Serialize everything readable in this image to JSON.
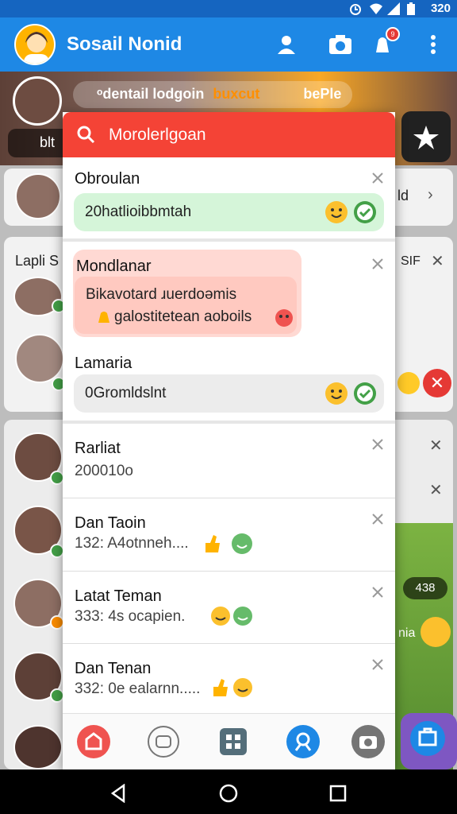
{
  "status_bar": {
    "time": "320"
  },
  "app_bar": {
    "title": "Sosail Nonid",
    "notification_count": "9"
  },
  "background": {
    "story_text": "ᵒdentail lodgoin",
    "story_highlight": "buxcut",
    "story_tail": "bePle",
    "pill_text": "blt",
    "card1_side_text": "ld",
    "card2_title": "Lapli S",
    "card2_side_text": "SIF",
    "map_value": "438",
    "map_label": "nia"
  },
  "modal": {
    "header_title": "Morolerlgoan",
    "rows": [
      {
        "name": "Obroulan",
        "bubble_text": "20hatlioibbmtah"
      },
      {
        "name": "Mondlanar",
        "bubble_line1": "Bikavotard ɹuerdoəmis",
        "bubble_line2": "galostitetean aoboils"
      },
      {
        "name": "Lamaria",
        "bubble_text": "0Gromldslnt"
      },
      {
        "name": "Rarliat",
        "sub": "200010o"
      },
      {
        "name": "Dan Taoin",
        "sub": "132: A4otnneh...."
      },
      {
        "name": "Latat Teman",
        "sub": "333: 4s ocapien."
      },
      {
        "name": "Dan Tenan",
        "sub": "332: 0e ealarnn....."
      }
    ]
  },
  "bottom_nav": {
    "items": [
      "home-tab",
      "groups-tab",
      "menu-tab",
      "profile-tab",
      "camera-tab",
      "store-tab"
    ]
  },
  "colors": {
    "primary": "#1e88e5",
    "header_red": "#f44336",
    "green_bubble": "#d5f5d9",
    "pink_bubble": "#ffd9d3",
    "gray_bubble": "#ececec"
  }
}
